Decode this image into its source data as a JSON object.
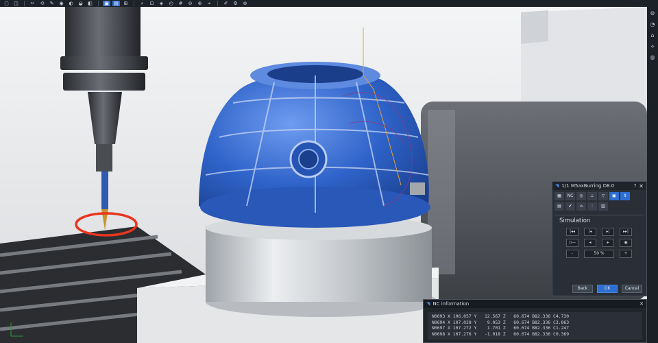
{
  "panel": {
    "title": "1/1 M5axBurring D8.0",
    "help": "?",
    "close": "✕",
    "tool_row1": [
      "▦",
      "NC",
      "◎",
      "⊥",
      "▽",
      "▣",
      "⇕"
    ],
    "tool_row2": [
      "▤",
      "✔",
      "⌂",
      "⫶",
      "▥"
    ],
    "simulation_label": "Simulation",
    "buttons_row1": [
      "|◂◂",
      "|◂",
      "▸|",
      "▸▸|"
    ],
    "buttons_row2": [
      "▫—",
      "◂",
      "▸",
      "◉"
    ],
    "minus": "-",
    "speed": "50 %",
    "plus": "+",
    "back": "Back",
    "ok": "OK",
    "cancel": "Cancel"
  },
  "nc": {
    "title": "NC information",
    "close": "✕",
    "lines": [
      "N0693 X 106.057 Y   12.567 Z   60.674 B82.336 C4.730",
      "N0694 X 107.028 Y    9.053 Z   60.674 B82.336 C3.863",
      "N0697 X 107.272 Y    1.701 Z   60.674 B82.336 C1.247",
      "N0698 X 107.276 Y   -1.018 Z   60.674 B82.336 C0.369"
    ]
  },
  "toolbar": {
    "icons": [
      "▢",
      "◫",
      "✂",
      "⟲",
      "✎",
      "◉",
      "◐",
      "◒",
      "◧",
      "▣",
      "▤",
      "⊞",
      "⌕",
      "⊡",
      "◈",
      "◴",
      "#",
      "⊖",
      "⊕",
      "⌖",
      "✐",
      "⚙",
      "⊕"
    ]
  },
  "rail": {
    "icons": [
      "⚙",
      "◔",
      "⌂",
      "⟡",
      "◍"
    ]
  },
  "colors": {
    "accent": "#2d6fd1",
    "part_blue": "#2f63c9",
    "highlight": "#e8351c"
  }
}
